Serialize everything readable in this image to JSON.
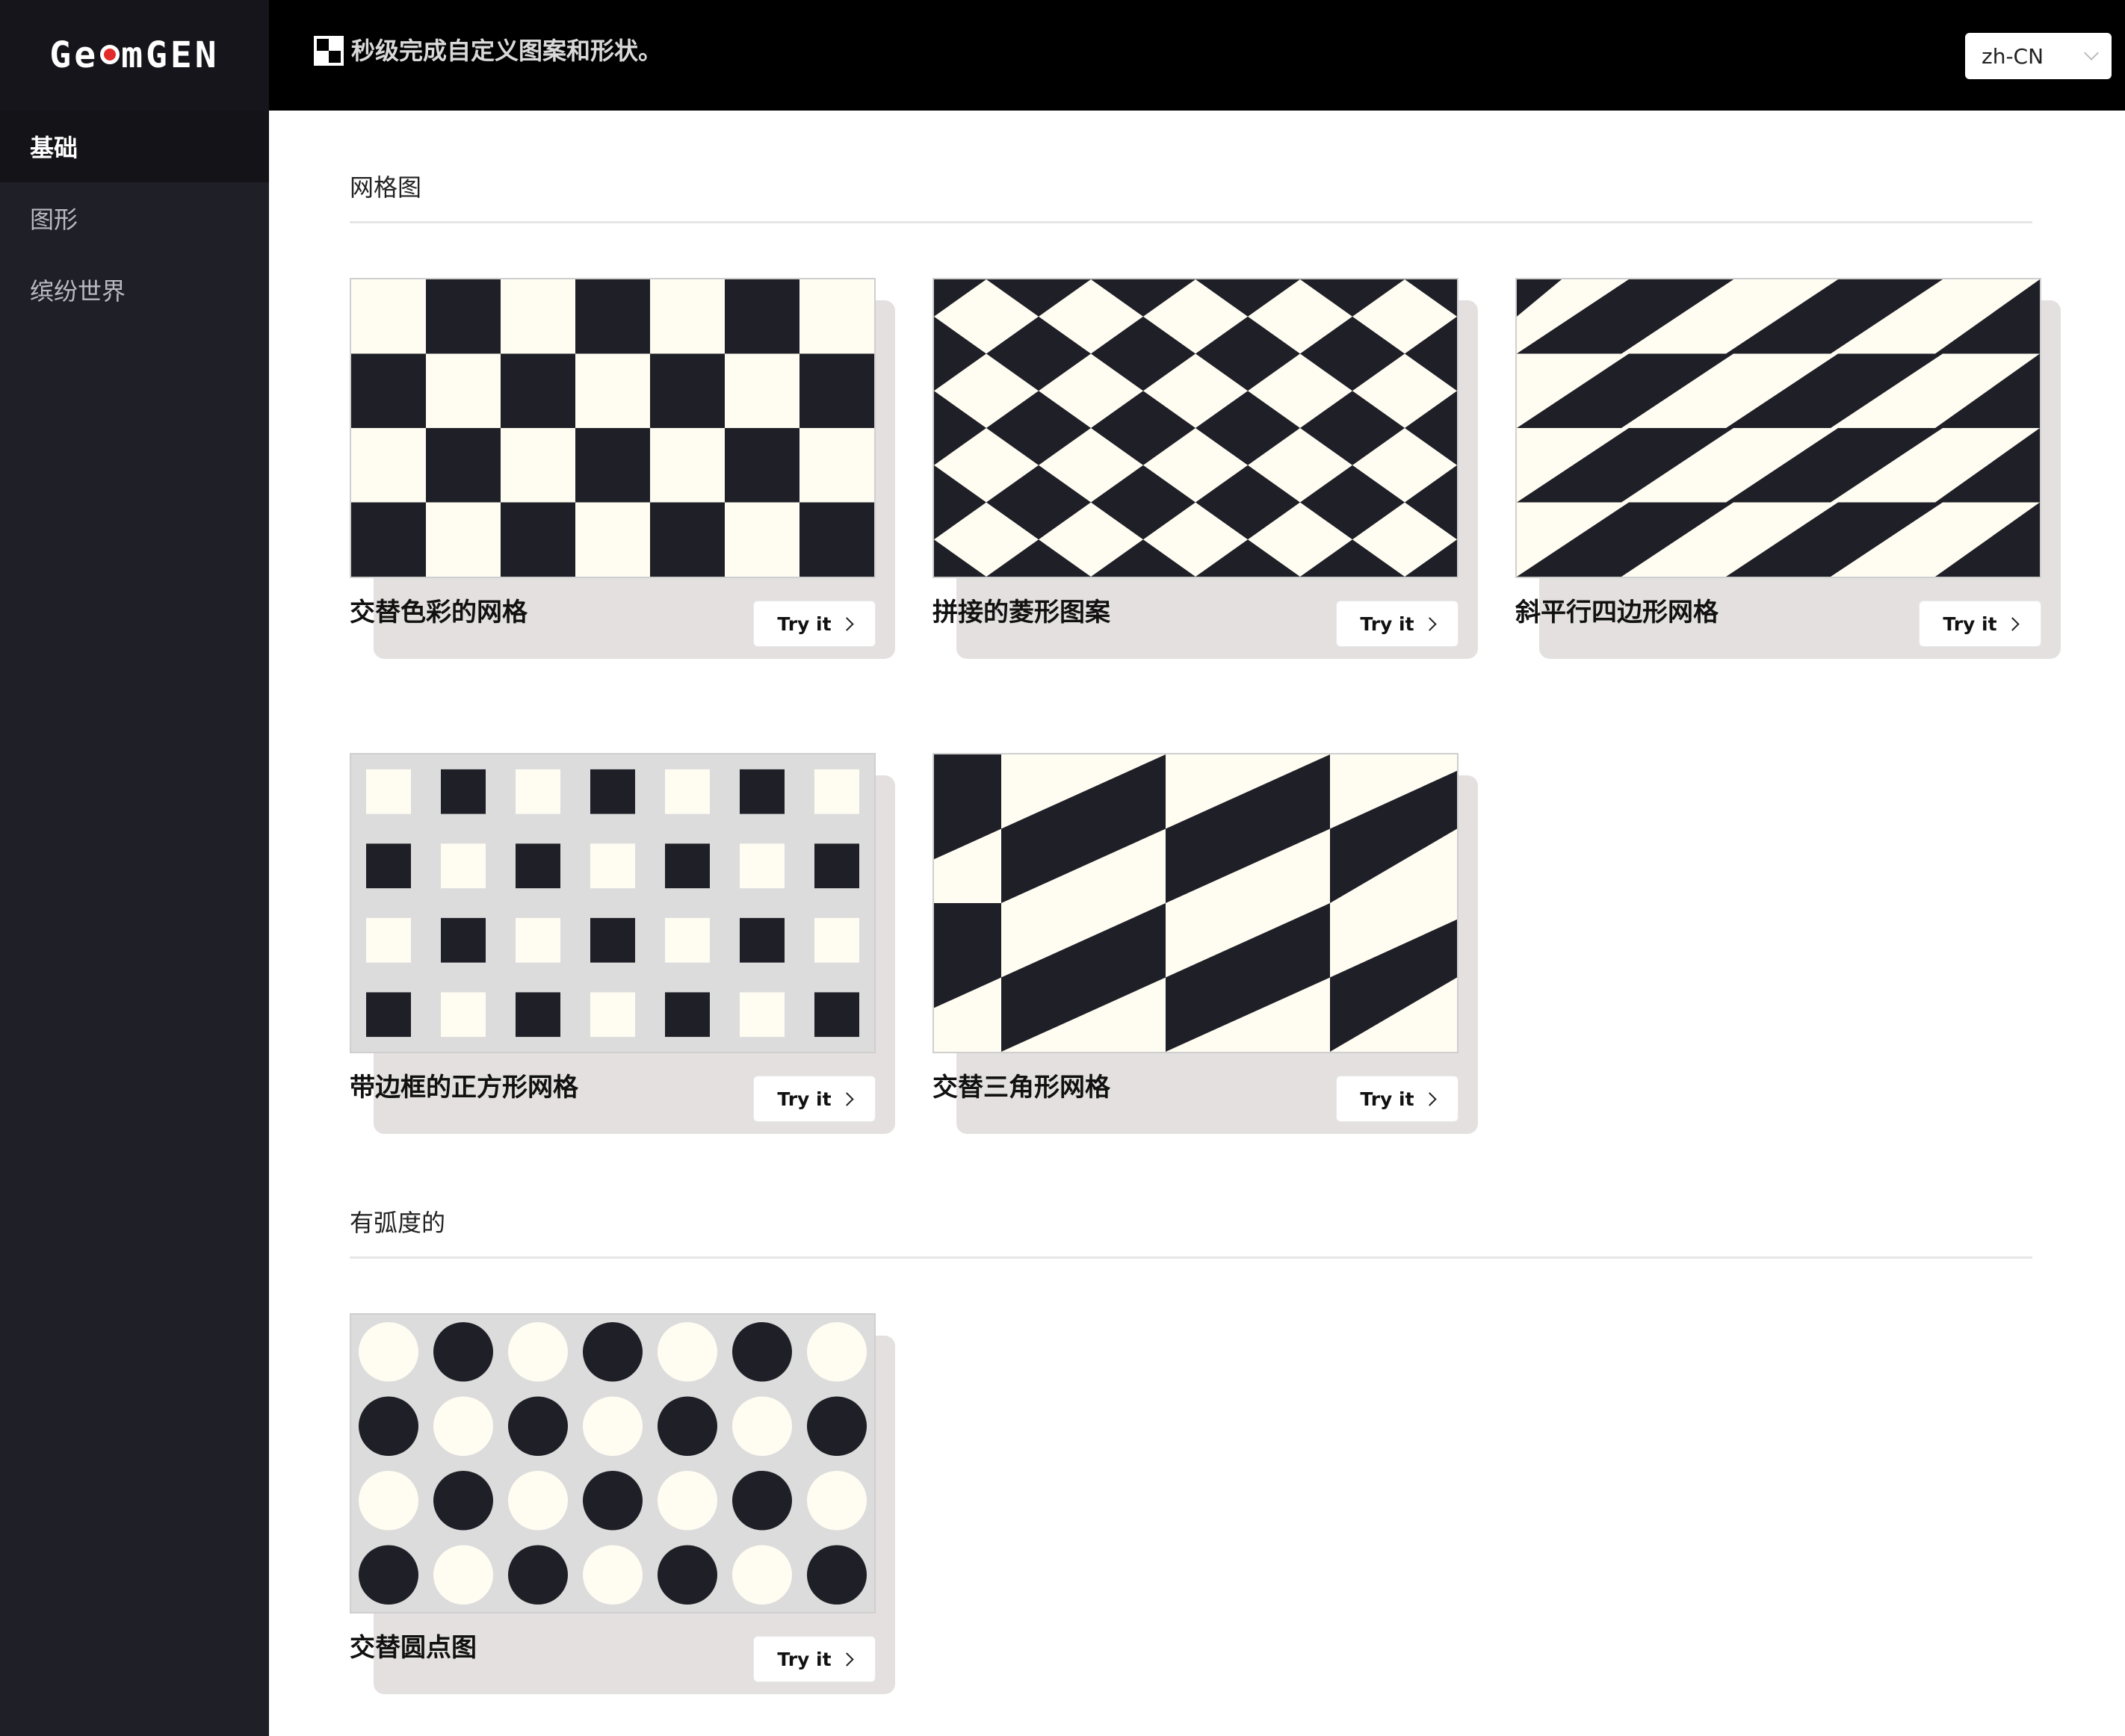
{
  "app": {
    "logo": "GeomGEN",
    "logo_left": "Ge",
    "logo_right": "mGEN"
  },
  "header": {
    "tagline": "秒级完成自定义图案和形状。",
    "language": "zh-CN"
  },
  "sidebar": {
    "items": [
      {
        "label": "基础"
      },
      {
        "label": "图形"
      },
      {
        "label": "缤纷世界"
      }
    ]
  },
  "sections": [
    {
      "title": "网格图"
    },
    {
      "title": "有弧度的"
    }
  ],
  "cards": [
    {
      "title": "交替色彩的网格",
      "button": "Try it"
    },
    {
      "title": "拼接的菱形图案",
      "button": "Try it"
    },
    {
      "title": "斜平行四边形网格",
      "button": "Try it"
    },
    {
      "title": "带边框的正方形网格",
      "button": "Try it"
    },
    {
      "title": "交替三角形网格",
      "button": "Try it"
    },
    {
      "title": "交替圆点图",
      "button": "Try it"
    }
  ],
  "colors": {
    "dark": "#1f1f27",
    "light": "#fffcf2",
    "bordered_bg": "#dcdcdc",
    "accent": "#e42b2b"
  }
}
